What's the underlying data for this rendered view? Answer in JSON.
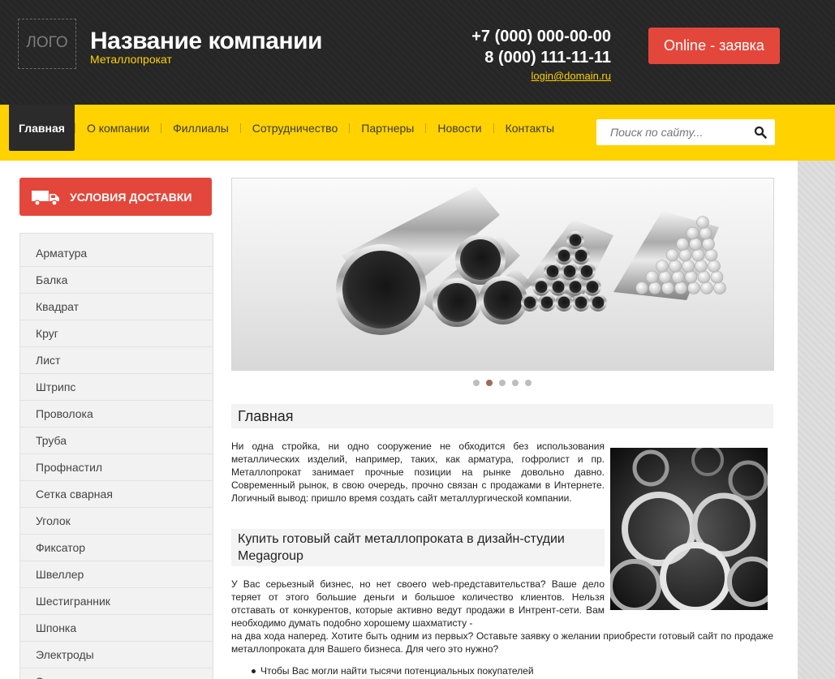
{
  "header": {
    "logo_text": "ЛОГО",
    "company_name": "Название компании",
    "company_subtitle": "Металлопрокат",
    "phone1": "+7 (000) 000-00-00",
    "phone2": "8 (000) 111-11-11",
    "email": "login@domain.ru",
    "online_button": "Online - заявка"
  },
  "nav": {
    "items": [
      {
        "label": "Главная",
        "active": true
      },
      {
        "label": "О компании"
      },
      {
        "label": "Филлиалы"
      },
      {
        "label": "Сотрудничество"
      },
      {
        "label": "Партнеры"
      },
      {
        "label": "Новости"
      },
      {
        "label": "Контакты"
      }
    ],
    "search_placeholder": "Поиск по сайту..."
  },
  "sidebar": {
    "delivery_button": "УСЛОВИЯ ДОСТАВКИ",
    "catalog": [
      "Арматура",
      "Балка",
      "Квадрат",
      "Круг",
      "Лист",
      "Штрипс",
      "Проволока",
      "Труба",
      "Профнастил",
      "Сетка сварная",
      "Уголок",
      "Фиксатор",
      "Швеллер",
      "Шестигранник",
      "Шпонка",
      "Электроды",
      "Эл..."
    ]
  },
  "slider": {
    "dots": 5,
    "active_dot": 2
  },
  "content": {
    "title": "Главная",
    "paragraph1": "Ни одна стройка, ни одно сооружение не обходится без использования металлических изделий, например, таких, как арматура, гофролист и пр. Металлопрокат занимает прочные позиции на рынке довольно давно. Современный рынок, в свою очередь, прочно связан с продажами в Интернете. Логичный вывод: пришло время создать сайт металлургической компании.",
    "subheading": "Купить готовый сайт металлопроката в дизайн-студии Megagroup",
    "paragraph2": "У Вас серьезный бизнес, но нет своего web-представительства? Ваше дело теряет от этого большие деньги и большое количество клиентов. Нельзя отставать от конкурентов, которые активно ведут продажи в Интрент-сети. Вам необходимо думать подобно хорошему шахматисту -",
    "paragraph2_tail": "на два хода наперед. Хотите быть одним из первых? Оставьте заявку о желании приобрести готовый сайт по продаже металлопроката для Вашего бизнеса. Для чего это нужно?",
    "bullet1": "Чтобы Вас могли найти тысячи потенциальных покупателей"
  },
  "colors": {
    "accent_yellow": "#ffd200",
    "accent_red": "#e3473b",
    "header_dark": "#262626"
  }
}
